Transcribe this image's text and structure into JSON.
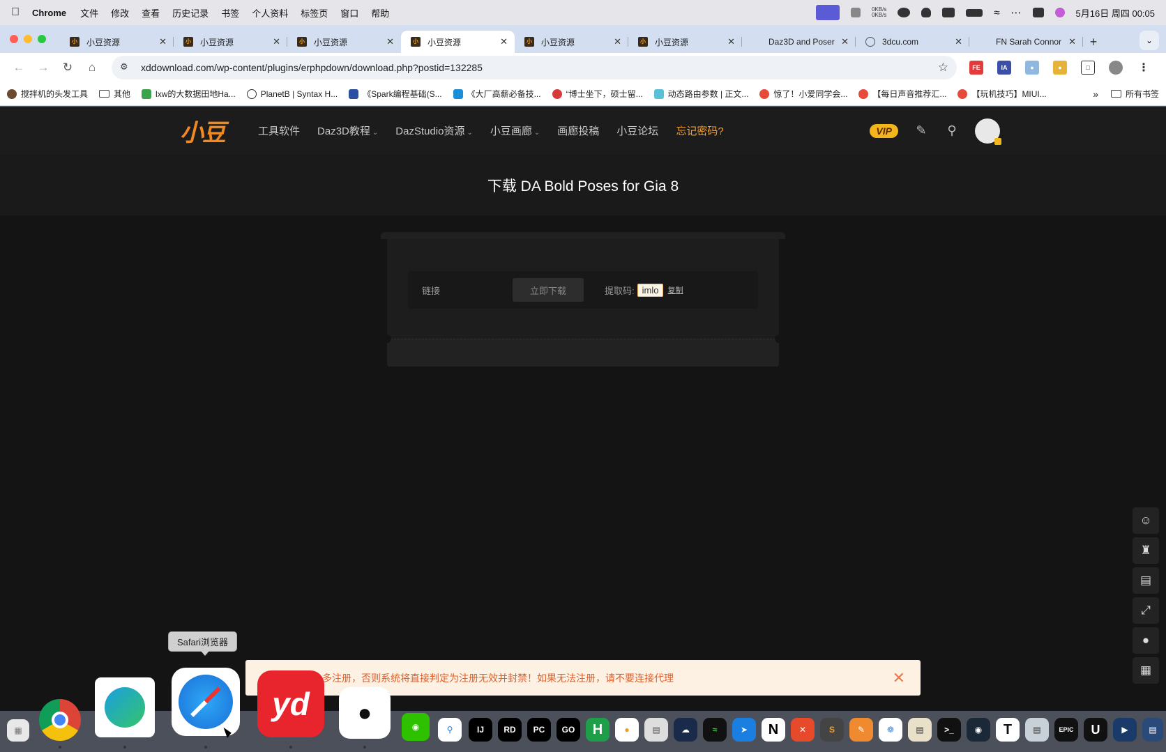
{
  "menubar": {
    "app_name": "Chrome",
    "items": [
      "文件",
      "修改",
      "查看",
      "历史记录",
      "书签",
      "个人资料",
      "标签页",
      "窗口",
      "帮助"
    ],
    "net_up": "0KB/s",
    "net_down": "0KB/s",
    "clock": "5月16日 周四 00:05"
  },
  "tabs": [
    {
      "title": "小豆资源",
      "active": false
    },
    {
      "title": "小豆资源",
      "active": false
    },
    {
      "title": "小豆资源",
      "active": false
    },
    {
      "title": "小豆资源",
      "active": true
    },
    {
      "title": "小豆资源",
      "active": false
    },
    {
      "title": "小豆资源",
      "active": false
    },
    {
      "title": "Daz3D and Poser",
      "active": false
    },
    {
      "title": "3dcu.com",
      "active": false
    },
    {
      "title": "FN Sarah Connor",
      "active": false
    }
  ],
  "toolbar": {
    "url": "xddownload.com/wp-content/plugins/erphpdown/download.php?postid=132285"
  },
  "bookmarks": [
    "搅拌机的头发工具",
    "其他",
    "lxw的大数据田地Ha...",
    "PlanetB | Syntax H...",
    "《Spark编程基础(S...",
    "《大厂高薪必备技...",
    "“博士坐下，硕士留...",
    "动态路由参数 | 正文...",
    "惊了！小爱同学会...",
    "【每日声音推荐汇...",
    "【玩机技巧】MIUI..."
  ],
  "bookmarks_all": "所有书签",
  "site": {
    "logo": "小豆",
    "nav": [
      {
        "label": "工具软件",
        "dropdown": false
      },
      {
        "label": "Daz3D教程",
        "dropdown": true
      },
      {
        "label": "DazStudio资源",
        "dropdown": true
      },
      {
        "label": "小豆画廊",
        "dropdown": true
      },
      {
        "label": "画廊投稿",
        "dropdown": false
      },
      {
        "label": "小豆论坛",
        "dropdown": false
      }
    ],
    "forgot_password": "忘记密码?",
    "vip": "VIP"
  },
  "download": {
    "title": "下载 DA Bold Poses for Gia 8",
    "link_label": "链接",
    "button": "立即下载",
    "code_label": "提取码:",
    "code_value": "imlo",
    "copy": "复制"
  },
  "notice": {
    "text": "多注册，否则系统将直接判定为注册无效并封禁！如果无法注册，请不要连接代理"
  },
  "dock": {
    "tooltip": "Safari浏览器"
  },
  "colors": {
    "accent": "#f08a20",
    "vip": "#f2b51c",
    "notice_text": "#e0602a",
    "page_bg": "#141414"
  }
}
